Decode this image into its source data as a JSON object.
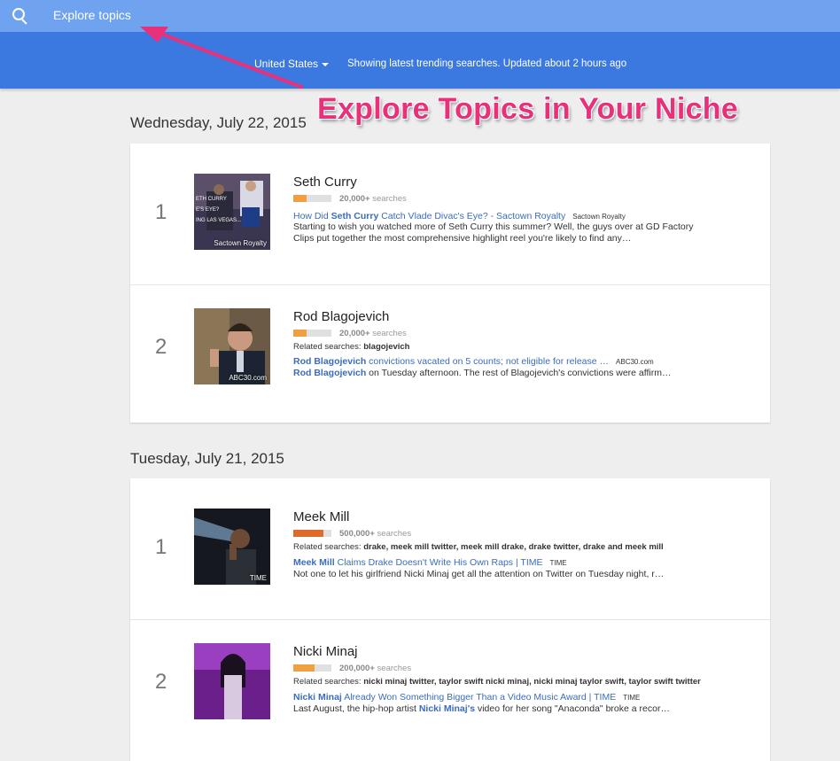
{
  "header": {
    "search_icon": "search-icon",
    "search_placeholder": "Explore topics"
  },
  "subbar": {
    "country": "United States",
    "status": "Showing latest trending searches. Updated about 2 hours ago"
  },
  "annotation": {
    "text": "Explore Topics in Your Niche",
    "color": "#e8317a"
  },
  "days": [
    {
      "date": "Wednesday, July 22, 2015",
      "items": [
        {
          "rank": "1",
          "title": "Seth Curry",
          "volume": "20,000+",
          "volume_suffix": "searches",
          "volume_fraction": 0.35,
          "related_label": "",
          "related": "",
          "thumb_caption": "Sactown Royalty",
          "article_bold": "Seth Curry",
          "article_pre": "How Did ",
          "article_post": " Catch Vlade Divac's Eye? - Sactown Royalty",
          "article_source": "Sactown Royalty",
          "snippet_bold": "",
          "snippet": "Starting to wish you watched more of Seth Curry this summer? Well, the guys over at GD Factory Clips put together the most comprehensive highlight reel you're likely to find any…"
        },
        {
          "rank": "2",
          "title": "Rod Blagojevich",
          "volume": "20,000+",
          "volume_suffix": "searches",
          "volume_fraction": 0.35,
          "related_label": "Related searches:",
          "related": "blagojevich",
          "thumb_caption": "ABC30.com",
          "article_bold": "Rod Blagojevich",
          "article_pre": "",
          "article_post": " convictions vacated on 5 counts; not eligible for release …",
          "article_source": "ABC30.com",
          "snippet_bold": "Rod Blagojevich",
          "snippet": " on Tuesday afternoon. The rest of Blagojevich's convictions were affirm…"
        }
      ]
    },
    {
      "date": "Tuesday, July 21, 2015",
      "items": [
        {
          "rank": "1",
          "title": "Meek Mill",
          "volume": "500,000+",
          "volume_suffix": "searches",
          "volume_fraction": 0.8,
          "related_label": "Related searches:",
          "related": "drake, meek mill twitter, meek mill drake, drake twitter, drake and meek mill",
          "thumb_caption": "TIME",
          "article_bold": "Meek Mill",
          "article_pre": "",
          "article_post": " Claims Drake Doesn't Write His Own Raps | TIME",
          "article_source": "TIME",
          "snippet_bold": "",
          "snippet": "Not one to let his girlfriend Nicki Minaj get all the attention on Twitter on Tuesday night, r…"
        },
        {
          "rank": "2",
          "title": "Nicki Minaj",
          "volume": "200,000+",
          "volume_suffix": "searches",
          "volume_fraction": 0.55,
          "related_label": "Related searches:",
          "related": "nicki minaj twitter, taylor swift nicki minaj, nicki minaj taylor swift, taylor swift twitter",
          "thumb_caption": "",
          "article_bold": "Nicki Minaj",
          "article_pre": "",
          "article_post": " Already Won Something Bigger Than a Video Music Award | TIME",
          "article_source": "TIME",
          "snippet_bold": "Nicki Minaj's",
          "snippet_pre": "Last August, the hip-hop artist ",
          "snippet": " video for her song \"Anaconda\" broke a recor…"
        }
      ]
    }
  ]
}
